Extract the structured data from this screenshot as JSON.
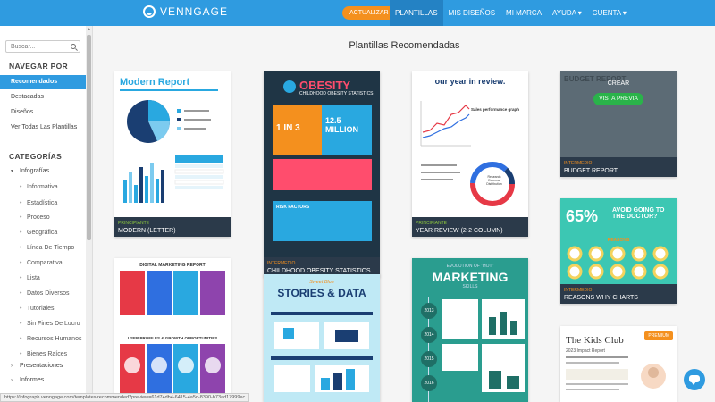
{
  "header": {
    "brand": "VENNGAGE",
    "update_label": "ACTUALIZAR",
    "nav": [
      "PLANTILLAS",
      "MIS DISEÑOS",
      "MI MARCA",
      "AYUDA ▾",
      "CUENTA ▾"
    ]
  },
  "sidebar": {
    "search_placeholder": "Buscar...",
    "browse_heading": "NAVEGAR POR",
    "browse_links": [
      "Recomendados",
      "Destacadas",
      "Diseños",
      "Ver Todas Las Plantillas"
    ],
    "categories_heading": "CATEGORÍAS",
    "categories": [
      "Infografías",
      "Presentaciones",
      "Informes"
    ],
    "infographic_subs": [
      "Informativa",
      "Estadística",
      "Proceso",
      "Geográfica",
      "Línea De Tiempo",
      "Comparativa",
      "Lista",
      "Datos Diversos",
      "Tutoriales",
      "Sin Fines De Lucro",
      "Recursos Humanos",
      "Bienes Raíces"
    ]
  },
  "main": {
    "title": "Plantillas Recomendadas",
    "cards": [
      {
        "tag": "PRINCIPIANTE",
        "title": "MODERN (LETTER)",
        "heading": "Modern Report"
      },
      {
        "tag": "INTERMEDIO",
        "title": "CHILDHOOD OBESITY STATISTICS",
        "heading": "OBESITY",
        "sub": "CHILDHOOD OBESITY STATISTICS",
        "stat1": "1 IN 3",
        "stat2": "12.5 MILLION",
        "risk": "RISK FACTORS"
      },
      {
        "tag": "PRINCIPIANTE",
        "title": "YEAR REVIEW (2-2 COLUMN)",
        "heading": "our year in review.",
        "sub": "Sales performance graph",
        "donut_label": "Research Expense Distribution"
      },
      {
        "tag": "INTERMEDIO",
        "title": "BUDGET REPORT",
        "heading": "BUDGET REPORT",
        "crear": "CREAR",
        "preview": "VISTA PREVIA"
      },
      {
        "tag": "INTERMEDIO",
        "title": "REASONS WHY CHARTS",
        "pct": "65%",
        "heading": "AVOID GOING TO THE DOCTOR?",
        "sub": "REASONS"
      },
      {
        "heading": "DIGITAL MARKETING REPORT",
        "sub": "USER PROFILES & GROWTH OPPORTUNITIES"
      },
      {
        "kicker": "Sweet Blue",
        "heading": "STORIES & DATA"
      },
      {
        "kicker": "EVOLUTION OF \"HOT\"",
        "heading": "MARKETING",
        "sub": "SKILLS",
        "years": [
          "2013",
          "2014",
          "2015",
          "2016"
        ]
      },
      {
        "premium": "PREMIUM",
        "heading": "The Kids Club",
        "sub": "2023 Impact Report"
      }
    ]
  },
  "status_url": "https://infograph.venngage.com/templates/recommended?preview=61d74db4-6415-4a5d-8390-b73ad17999ec",
  "colors": {
    "accent": "#2f9be0",
    "update": "#f4901e",
    "card_footer": "#2b3a4a",
    "preview": "#2ab34a"
  }
}
